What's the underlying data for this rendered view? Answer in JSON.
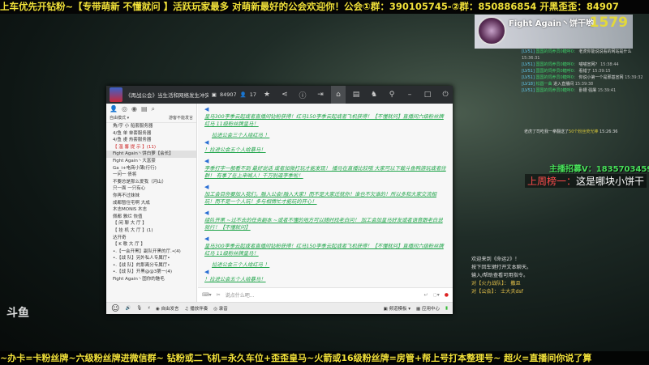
{
  "top_banner": "上车优先开钻粉~【专带萌新 不懂就问 】活跃玩家最多 对萌新最好的公会欢迎你！公会①群：390105745-②群：850886854 开黑歪歪：84907",
  "bottom_banner": "~办卡=卡粉丝牌~六级粉丝牌进微信群~ 钻粉或二飞机=永久车位+歪歪皇马~火箭或16级粉丝牌=房管+帮上号打本整理号~ 超火=直播间你说了算",
  "window": {
    "title": "《再战公会》当生活和网络发生冲突的时候请选择前者！还有这里...",
    "channel_id": "84907",
    "user_count": "17",
    "mode_label": "自由模式",
    "mode_right": "游客不能发言",
    "channels": [
      {
        "t": "角/宇  小  船套服务器"
      },
      {
        "t": "4/鱼  单  单套服务器"
      },
      {
        "t": "4/鱼  虔  热套服务器"
      },
      {
        "t": "【  温  馨  提  示  】(11)",
        "red": true
      },
      {
        "t": "Fight Again丶饼白萝【会长】",
        "sel": true
      },
      {
        "t": "Fight Again丶大富豪"
      },
      {
        "t": "Ga_i+电商小薄(行行)"
      },
      {
        "t": "一问一  债将"
      },
      {
        "t": "不要总是那么爱我（河山）"
      },
      {
        "t": "只一面  一只有心"
      },
      {
        "t": "你再不过妹妹"
      },
      {
        "t": "成都暂住宅啊  大成"
      },
      {
        "t": "木志MONIS  木志"
      },
      {
        "t": "佩都 雅烂 恢值"
      },
      {
        "t": "【   闲  聊  大  厅   】"
      },
      {
        "t": "【   挂  机  大  厅   】(1)"
      },
      {
        "t": "达开奇"
      },
      {
        "t": "【   K  歌  大  厅   】"
      },
      {
        "t": "•.【一会开黑】副队开黑的厅.•(4)"
      },
      {
        "t": "•.【战 队】另外私人专属厅•"
      },
      {
        "t": "•.【战 队】的那离分专属厅•"
      },
      {
        "t": "•.【战 队】开黑@@3第一(4)"
      },
      {
        "t": "Fight Again丶固你的魅毛"
      }
    ],
    "messages": [
      {
        "text": "皇马300李季云起或者直播间钻粉获得！红马150李季云起或者飞机获得！【不懂就问】直播间六级粉丝牌红马  11级粉丝牌皇马！"
      },
      {
        "pre": "拉进公会三个人给红马 ！",
        "text": "！拉进公会五个人给暴马！"
      },
      {
        "text": "李季打字一般看不到 最好说话 或者加微打玩才能发现！  播马在直播比较哦 大家可以下载斗鱼鸭游玩或者往群！ 有事了在上来喊人！千万别逼李季啦！"
      },
      {
        "text": "加工会目你要加入我们，融入公会!融入大家！而不是大家迁就你！谁也不欠谁的！所以多和大家交流相玩！而不是一个人玩！多与相情忙才能玩的开心！"
      },
      {
        "text": "组队开黑 ~过不去的任务副本 ~或者不懂的地方可以随时找老白问！ 加工会加皇马好友或者语音跟老白说就行！【不懂就问】"
      },
      {
        "text": "皇马300李季云起或者直播间钻粉获得！红马150李季云起或者飞机获得！【不懂就问】直播间六级粉丝牌红马  11级粉丝牌皇马！"
      },
      {
        "pre": "拉进公会三个人给红马 ！",
        "text": "！拉进公会五个人给暴马！"
      }
    ],
    "input_placeholder": "说点什么吧...",
    "footer": {
      "music": "播放伴奏",
      "record": "录音",
      "mic_mode": "自由发言",
      "settings": "频道模板",
      "app_center": "应用中心"
    }
  },
  "overlay": {
    "name": "Fight Again丶饼干哟",
    "count": "1579",
    "log": [
      {
        "lv": "[LV51]",
        "nm": "国国的饲养员0糖呼0：",
        "msg": "老虎你能说说看的网站是什么",
        "t": "15:36:31"
      },
      {
        "lv": "[LV51]",
        "nm": "国国的饲养员0糖呼0：",
        "msg": "喵喵宣网？",
        "t": "15:38:44"
      },
      {
        "lv": "[LV51]",
        "nm": "国国的饲养员0糖呼0：",
        "msg": "看错了",
        "t": "15:39:15"
      },
      {
        "lv": "[LV51]",
        "nm": "国国的饲养员0糖呼0：",
        "msg": "你说小第一个是邪基宣网",
        "t": "15:39:32"
      },
      {
        "lv": "[LV18]",
        "nm": "松圆一曲",
        "msg": "进入直播间",
        "t": "15:39:38"
      },
      {
        "lv": "[LV51]",
        "nm": "国国的饲养员0糖呼0：",
        "msg": "卧槽 强屠",
        "t": "15:39:41"
      }
    ],
    "gift": {
      "pre": "老虎了司吃我一拳翻送了",
      "item": "50个粉丝荧光棒",
      "t": "15:26:36"
    },
    "recruit": "主播招募V：1835703459",
    "weekly_label": "上周榜一：",
    "weekly_name": "这是哪块小饼干",
    "game_chat": [
      "欢迎来到《命运2》！",
      "按下回车键打开文本聊天。",
      "输入/帮助查看可用指令。",
      "对【火力战队】：  撒旦",
      "对【公会】：  士大夫dsf"
    ],
    "platform": "斗鱼"
  }
}
